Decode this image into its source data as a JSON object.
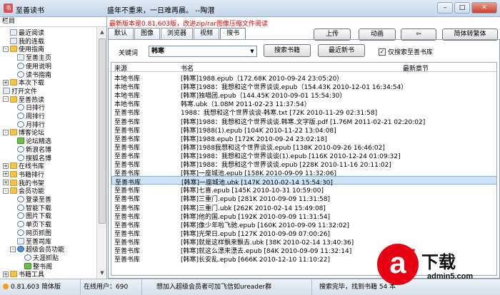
{
  "window": {
    "title": "至善读书",
    "motto": "盛年不重来，一日难再晨。 --陶潜"
  },
  "sidebar": {
    "header": "栏目",
    "items": [
      {
        "label": "最近阅读",
        "level": 1,
        "icon": "page"
      },
      {
        "label": "我的连载",
        "level": 1,
        "icon": "page"
      },
      {
        "label": "使用指南",
        "level": 0,
        "icon": "folder",
        "expander": "-"
      },
      {
        "label": "至善主页",
        "level": 2,
        "icon": "page"
      },
      {
        "label": "使用说明",
        "level": 2,
        "icon": "lens"
      },
      {
        "label": "读书指南",
        "level": 2,
        "icon": "lens"
      },
      {
        "label": "本次下载",
        "level": 0,
        "icon": "folder",
        "expander": "+"
      },
      {
        "label": "打开文件",
        "level": 0,
        "icon": "page"
      },
      {
        "label": "至善热读",
        "level": 0,
        "icon": "folder",
        "expander": "-"
      },
      {
        "label": "日排行",
        "level": 2,
        "icon": "lens"
      },
      {
        "label": "周排行",
        "level": 2,
        "icon": "lens"
      },
      {
        "label": "月排行",
        "level": 2,
        "icon": "lens"
      },
      {
        "label": "博客论坛",
        "level": 0,
        "icon": "folder",
        "expander": "-"
      },
      {
        "label": "论坛精选",
        "level": 2,
        "icon": "star"
      },
      {
        "label": "新浪名博",
        "level": 2,
        "icon": "lens"
      },
      {
        "label": "搜狐名博",
        "level": 2,
        "icon": "lens"
      },
      {
        "label": "在线书库",
        "level": 0,
        "icon": "folder",
        "expander": "+"
      },
      {
        "label": "书籍排行",
        "level": 0,
        "icon": "folder",
        "expander": "+"
      },
      {
        "label": "我的书架",
        "level": 0,
        "icon": "folder",
        "expander": "+"
      },
      {
        "label": "会员功能",
        "level": 0,
        "icon": "folder",
        "expander": "-"
      },
      {
        "label": "登录至善",
        "level": 2,
        "icon": "lens"
      },
      {
        "label": "智能下载",
        "level": 2,
        "icon": "lens"
      },
      {
        "label": "图片下载",
        "level": 2,
        "icon": "lens"
      },
      {
        "label": "单页下载",
        "level": 2,
        "icon": "lens"
      },
      {
        "label": "网页抓图",
        "level": 2,
        "icon": "lens"
      },
      {
        "label": "至善司库",
        "level": 2,
        "icon": "page"
      },
      {
        "label": "超级会员功能",
        "level": 1,
        "icon": "globe",
        "expander": "-"
      },
      {
        "label": "天涯抓贴",
        "level": 3,
        "icon": "lens"
      },
      {
        "label": "整书阁",
        "level": 3,
        "icon": "star"
      },
      {
        "label": "书籍工具",
        "level": 0,
        "icon": "folder",
        "expander": "+"
      }
    ]
  },
  "main": {
    "notice": "最新版本是0.81.603版，改进zip/rar图像压缩文件阅读",
    "tabs": [
      {
        "label": "默认",
        "active": false
      },
      {
        "label": "图像",
        "active": false
      },
      {
        "label": "浏览器",
        "active": false
      },
      {
        "label": "视频",
        "active": false
      },
      {
        "label": "搜书",
        "active": true
      }
    ],
    "toolbar": {
      "upload": "上传",
      "animate": "动画",
      "back_arrow": "⇦",
      "convert": "简体转繁体"
    },
    "search": {
      "keyword_label": "关键词",
      "keyword_value": "韩寒",
      "search_button": "搜索书籍",
      "latest_button": "最近新书",
      "only_zhishan_checked": true,
      "only_zhishan_label": "仅搜索至善书库"
    },
    "table": {
      "columns": [
        "来源",
        "书名",
        "最新章节"
      ],
      "selected_index": 12,
      "rows": [
        {
          "source": "本地书库",
          "title": "[韩寒]1988.epub（172.68K 2010-09-24 23:05:20）"
        },
        {
          "source": "本地书库",
          "title": "[韩寒]1988：我想和这个世界谈谈.epub（154.43K 2010-12-01 16:34:54）"
        },
        {
          "source": "本地书库",
          "title": "[韩寒]独唱团.epub（144.45K 2010-09-01 15:54:30）"
        },
        {
          "source": "本地书库",
          "title": "韩寒.ubk（1.08M 2011-02-23 11:37:54）"
        },
        {
          "source": "至善书库",
          "title": "1988：我想和这个世界谈谈-韩寒.txt [72K 2010-11-29 02:31:58]"
        },
        {
          "source": "至善书库",
          "title": "[韩寒]1988：我想和这个世界谈谈.韩寒.文字版.pdf [1.76M 2011-02-21 02:20:02]"
        },
        {
          "source": "至善书库",
          "title": "[韩寒]1988(1).epub [104K 2010-11-22 13:04:08]"
        },
        {
          "source": "至善书库",
          "title": "[韩寒]1988.epub [172K 2010-09-24 23:02:18]"
        },
        {
          "source": "至善书库",
          "title": "[韩寒]1988我想和这个世界谈谈.epub [138K 2010-09-26 16:46:02]"
        },
        {
          "source": "至善书库",
          "title": "[韩寒]1988：我想和这个世界谈谈(1).epub [116K 2010-12-24 01:09:32]"
        },
        {
          "source": "至善书库",
          "title": "[韩寒]1988：我想和这个世界谈谈.epub [228K 2010-11-16 20:11:02]"
        },
        {
          "source": "至善书库",
          "title": "[韩寒]一座城池.epub [158K 2010-09-09 11:32:06]"
        },
        {
          "source": "至善书库",
          "title": "[韩寒]一座城池.ubk [147K 2010-02-14 15:54:30]"
        },
        {
          "source": "至善书库",
          "title": "[韩寒]七喜.epub [145K 2010-10-31 10:59:00]"
        },
        {
          "source": "至善书库",
          "title": "[韩寒]三重门.epub [281K 2010-09-09 11:31:58]"
        },
        {
          "source": "至善书库",
          "title": "[韩寒]三重门.ubk [262K 2010-02-14 15:49:08]"
        },
        {
          "source": "至善书库",
          "title": "[韩寒]他的国.epub [192K 2010-09-09 11:31:54]"
        },
        {
          "source": "至善书库",
          "title": "[韩寒]像少年啦飞驰.epub [160K 2010-09-09 11:32:02]"
        },
        {
          "source": "至善书库",
          "title": "[韩寒]光荣日.epub [127K 2010-09-09 07:00:26]"
        },
        {
          "source": "至善书库",
          "title": "[韩寒]就是这样飘来飘去.ubk [38K 2010-02-14 13:40:36]"
        },
        {
          "source": "至善书库",
          "title": "[韩寒]就这么漂来漂去.epub [84K 2010-09-09 11:32:14]"
        },
        {
          "source": "至善书库",
          "title": "[韩寒]长安乱.epub [666K 2010-12-10 11:10:22]"
        }
      ]
    }
  },
  "status": {
    "version": "0.81.603 简体版",
    "online": "在线用户：690",
    "promo": "想加入超级会员者可加飞信如ureader群",
    "result": "搜索完毕，找到书籍 54 本"
  },
  "watermark": {
    "letter": "a",
    "digit": "5",
    "dl": "下载",
    "url": "admin5.com"
  }
}
